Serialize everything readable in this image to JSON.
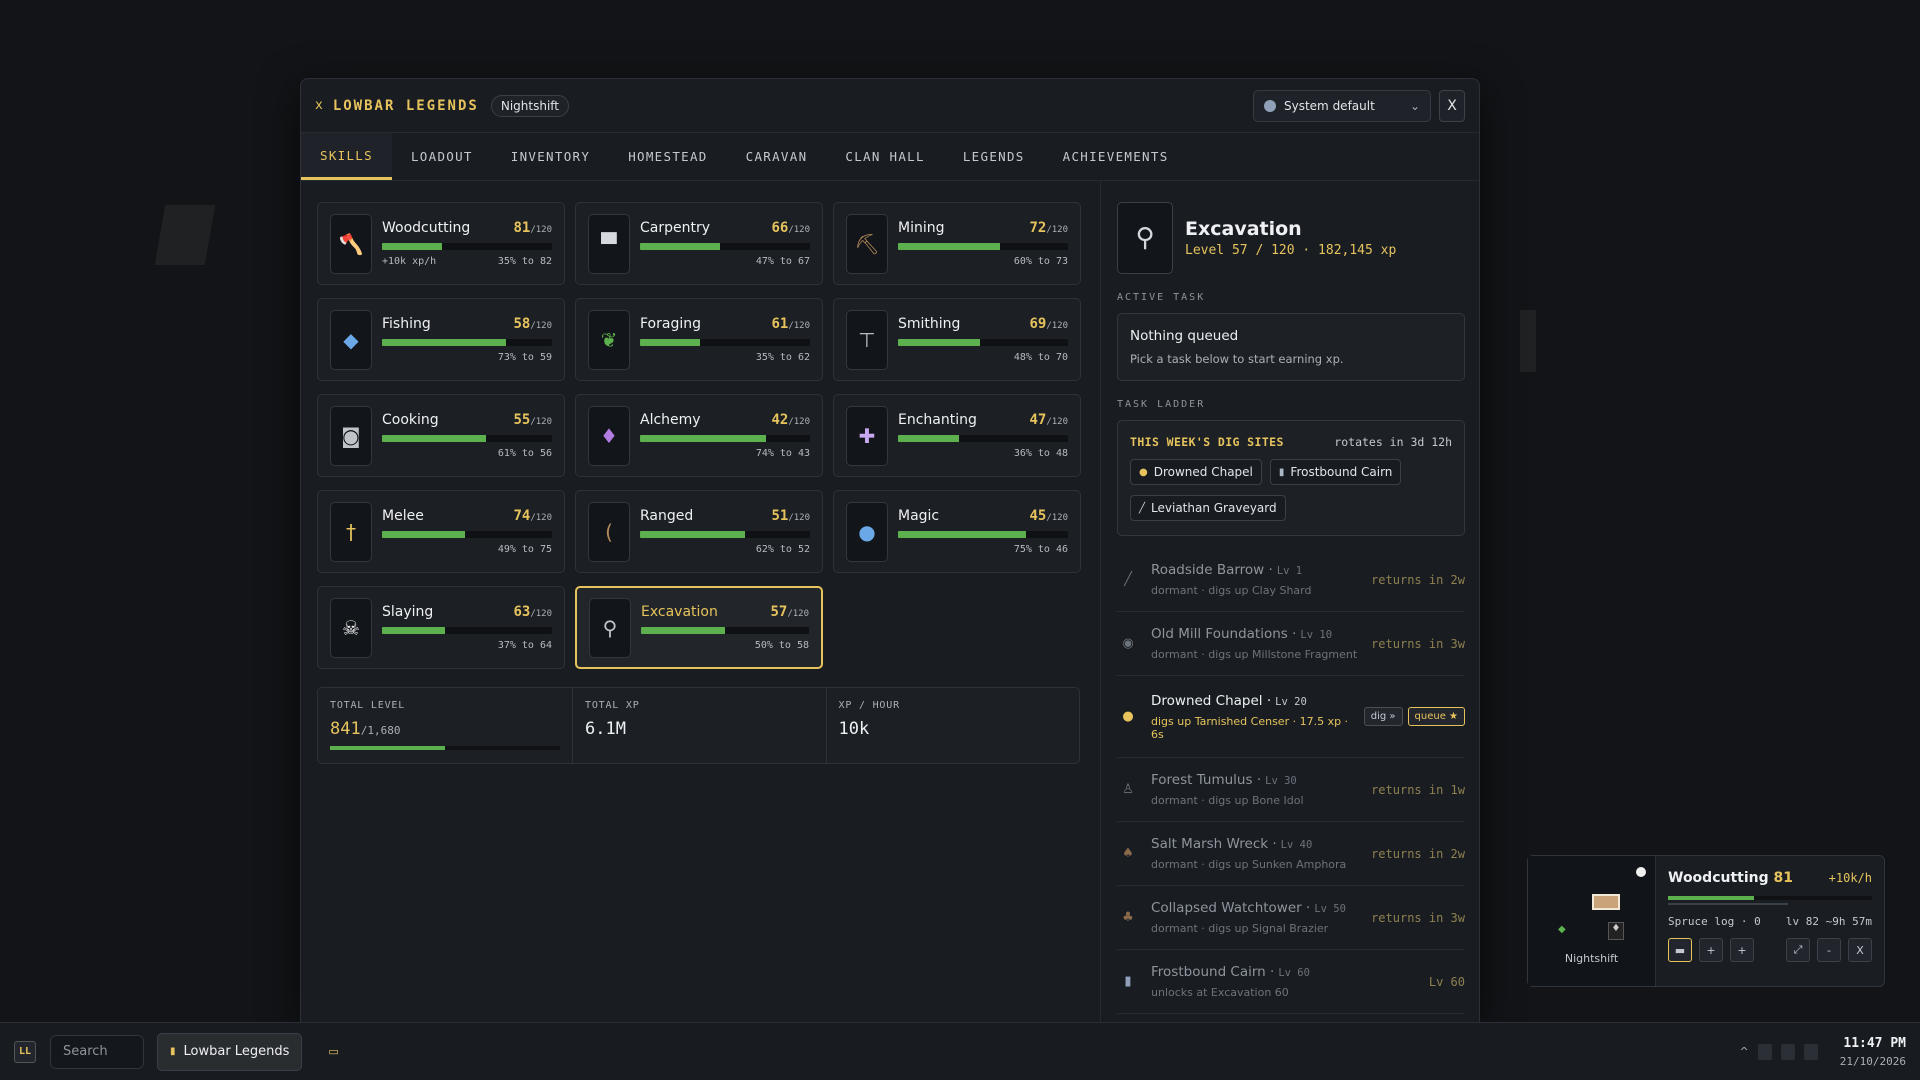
{
  "window": {
    "close_glyph": "x",
    "title": "LOWBAR LEGENDS",
    "profile": "Nightshift",
    "language": "System default",
    "close_label": "X"
  },
  "tabs": [
    "SKILLS",
    "LOADOUT",
    "INVENTORY",
    "HOMESTEAD",
    "CARAVAN",
    "CLAN HALL",
    "LEGENDS",
    "ACHIEVEMENTS"
  ],
  "skills": [
    {
      "name": "Woodcutting",
      "level": "81",
      "max": "/120",
      "progress": 0.35,
      "left": "+10k xp/h",
      "right": "35% to 82",
      "icon": "axe-icon"
    },
    {
      "name": "Carpentry",
      "level": "66",
      "max": "/120",
      "progress": 0.47,
      "left": "",
      "right": "47% to 67",
      "icon": "saw-icon"
    },
    {
      "name": "Mining",
      "level": "72",
      "max": "/120",
      "progress": 0.6,
      "left": "",
      "right": "60% to 73",
      "icon": "pickaxe-icon"
    },
    {
      "name": "Fishing",
      "level": "58",
      "max": "/120",
      "progress": 0.73,
      "left": "",
      "right": "73% to 59",
      "icon": "fish-icon"
    },
    {
      "name": "Foraging",
      "level": "61",
      "max": "/120",
      "progress": 0.35,
      "left": "",
      "right": "35% to 62",
      "icon": "leaf-icon"
    },
    {
      "name": "Smithing",
      "level": "69",
      "max": "/120",
      "progress": 0.48,
      "left": "",
      "right": "48% to 70",
      "icon": "anvil-icon"
    },
    {
      "name": "Cooking",
      "level": "55",
      "max": "/120",
      "progress": 0.61,
      "left": "",
      "right": "61% to 56",
      "icon": "pot-icon"
    },
    {
      "name": "Alchemy",
      "level": "42",
      "max": "/120",
      "progress": 0.74,
      "left": "",
      "right": "74% to 43",
      "icon": "potion-icon"
    },
    {
      "name": "Enchanting",
      "level": "47",
      "max": "/120",
      "progress": 0.36,
      "left": "",
      "right": "36% to 48",
      "icon": "sparkle-icon"
    },
    {
      "name": "Melee",
      "level": "74",
      "max": "/120",
      "progress": 0.49,
      "left": "",
      "right": "49% to 75",
      "icon": "sword-icon"
    },
    {
      "name": "Ranged",
      "level": "51",
      "max": "/120",
      "progress": 0.62,
      "left": "",
      "right": "62% to 52",
      "icon": "bow-icon"
    },
    {
      "name": "Magic",
      "level": "45",
      "max": "/120",
      "progress": 0.75,
      "left": "",
      "right": "75% to 46",
      "icon": "orb-icon"
    },
    {
      "name": "Slaying",
      "level": "63",
      "max": "/120",
      "progress": 0.37,
      "left": "",
      "right": "37% to 64",
      "icon": "skull-icon"
    },
    {
      "name": "Excavation",
      "level": "57",
      "max": "/120",
      "progress": 0.5,
      "left": "",
      "right": "50% to 58",
      "icon": "shovel-icon",
      "selected": true
    }
  ],
  "totals": {
    "level_label": "TOTAL LEVEL",
    "level": "841",
    "level_max": "/1,680",
    "level_progress": 0.5,
    "xp_label": "TOTAL XP",
    "xp": "6.1M",
    "rate_label": "XP / HOUR",
    "rate": "10k"
  },
  "detail": {
    "name": "Excavation",
    "sub": "Level 57 / 120 · 182,145 xp",
    "active_label": "ACTIVE TASK",
    "active_title": "Nothing queued",
    "active_sub": "Pick a task below to start earning xp.",
    "ladder_label": "TASK LADDER",
    "week_title": "THIS WEEK'S DIG SITES",
    "rotates": "rotates in 3d 12h",
    "chips": [
      "Drowned Chapel",
      "Frostbound Cairn",
      "Leviathan Graveyard"
    ]
  },
  "ladder": [
    {
      "name": "Roadside Barrow",
      "lv": "Lv 1",
      "desc": "dormant · digs up Clay Shard",
      "right": "returns in 2w"
    },
    {
      "name": "Old Mill Foundations",
      "lv": "Lv 10",
      "desc": "dormant · digs up Millstone Fragment",
      "right": "returns in 3w"
    },
    {
      "name": "Drowned Chapel",
      "lv": "Lv 20",
      "desc": "digs up Tarnished Censer · 17.5 xp · 6s",
      "btn1": "dig »",
      "btn2": "queue ★",
      "active": true
    },
    {
      "name": "Forest Tumulus",
      "lv": "Lv 30",
      "desc": "dormant · digs up Bone Idol",
      "right": "returns in 1w"
    },
    {
      "name": "Salt Marsh Wreck",
      "lv": "Lv 40",
      "desc": "dormant · digs up Sunken Amphora",
      "right": "returns in 2w"
    },
    {
      "name": "Collapsed Watchtower",
      "lv": "Lv 50",
      "desc": "dormant · digs up Signal Brazier",
      "right": "returns in 3w"
    },
    {
      "name": "Frostbound Cairn",
      "lv": "Lv 60",
      "desc": "unlocks at Excavation 60",
      "right": "Lv 60"
    }
  ],
  "mini": {
    "skill": "Woodcutting",
    "level": "81",
    "rate": "+10k/h",
    "item": "Spruce log · 0",
    "eta": "lv 82 ~9h 57m",
    "profile": "Nightshift",
    "progress": 0.42
  },
  "taskbar": {
    "logo": "LL",
    "search": "Search",
    "app": "Lowbar Legends",
    "time": "11:47 PM",
    "date": "21/10/2026"
  }
}
